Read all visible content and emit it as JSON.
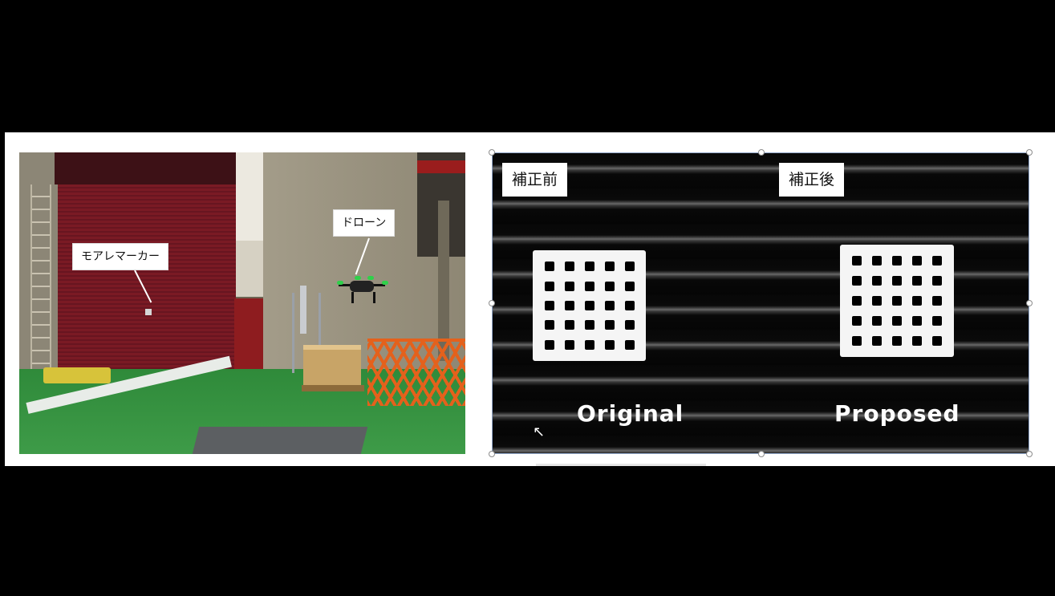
{
  "photo_callouts": {
    "marker_label": "モアレマーカー",
    "drone_label": "ドローン"
  },
  "panel": {
    "before_label": "補正前",
    "after_label": "補正後",
    "original_caption": "Original",
    "proposed_caption": "Proposed"
  },
  "colors": {
    "background": "#000000",
    "slide": "#ffffff",
    "shutter_red": "#7a1a24",
    "floor_green": "#3e9b48",
    "fence_orange": "#e4611c",
    "selection_border": "#8fa5c8"
  },
  "icons": [
    "cursor-icon"
  ]
}
